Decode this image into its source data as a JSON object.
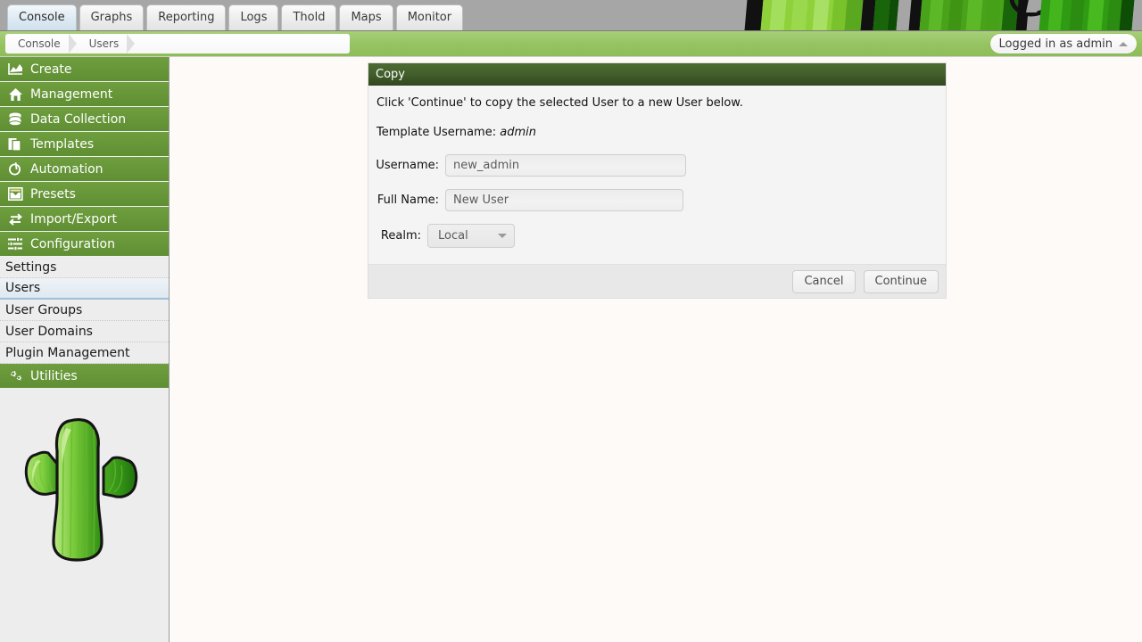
{
  "app": {
    "title": "Cacti",
    "banner_icon": "cactus-banner-image"
  },
  "topbar": {
    "tabs": [
      {
        "label": "Console",
        "selected": true
      },
      {
        "label": "Graphs",
        "selected": false
      },
      {
        "label": "Reporting",
        "selected": false
      },
      {
        "label": "Logs",
        "selected": false
      },
      {
        "label": "Thold",
        "selected": false
      },
      {
        "label": "Maps",
        "selected": false
      },
      {
        "label": "Monitor",
        "selected": false
      }
    ]
  },
  "breadcrumb": {
    "items": [
      {
        "label": "Console"
      },
      {
        "label": "Users"
      }
    ]
  },
  "user_menu": {
    "label": "Logged in as admin",
    "caret_icon": "caret-up-icon"
  },
  "sidebar": {
    "sections": [
      {
        "label": "Create",
        "icon": "chart-area-icon"
      },
      {
        "label": "Management",
        "icon": "home-icon"
      },
      {
        "label": "Data Collection",
        "icon": "database-icon"
      },
      {
        "label": "Templates",
        "icon": "copy-pages-icon"
      },
      {
        "label": "Automation",
        "icon": "refresh-circle-icon"
      },
      {
        "label": "Presets",
        "icon": "archive-box-icon"
      },
      {
        "label": "Import/Export",
        "icon": "exchange-arrows-icon"
      },
      {
        "label": "Configuration",
        "icon": "sliders-icon"
      }
    ],
    "config_items": [
      {
        "label": "Settings",
        "selected": false
      },
      {
        "label": "Users",
        "selected": true
      },
      {
        "label": "User Groups",
        "selected": false
      },
      {
        "label": "User Domains",
        "selected": false
      },
      {
        "label": "Plugin Management",
        "selected": false
      }
    ],
    "utilities": {
      "label": "Utilities",
      "icon": "gears-icon"
    },
    "logo_icon": "cactus-logo"
  },
  "panel": {
    "title": "Copy",
    "instruction": "Click 'Continue' to copy the selected User to a new User below.",
    "template_label": "Template Username:",
    "template_value": "admin",
    "fields": [
      {
        "label": "Username:",
        "value": "new_admin",
        "type": "text"
      },
      {
        "label": "Full Name:",
        "value": "New User",
        "type": "text"
      },
      {
        "label": "Realm:",
        "value": "Local",
        "type": "select"
      }
    ],
    "realm_options": [
      "Local"
    ],
    "buttons": {
      "cancel": "Cancel",
      "continue": "Continue"
    }
  },
  "colors": {
    "nav_green": "#5f8f33",
    "breadcrumb_green": "#96c463",
    "panel_header": "#43602c",
    "tabbar_gray": "#A6A6A6",
    "content_bg": "#FDFAF7"
  }
}
